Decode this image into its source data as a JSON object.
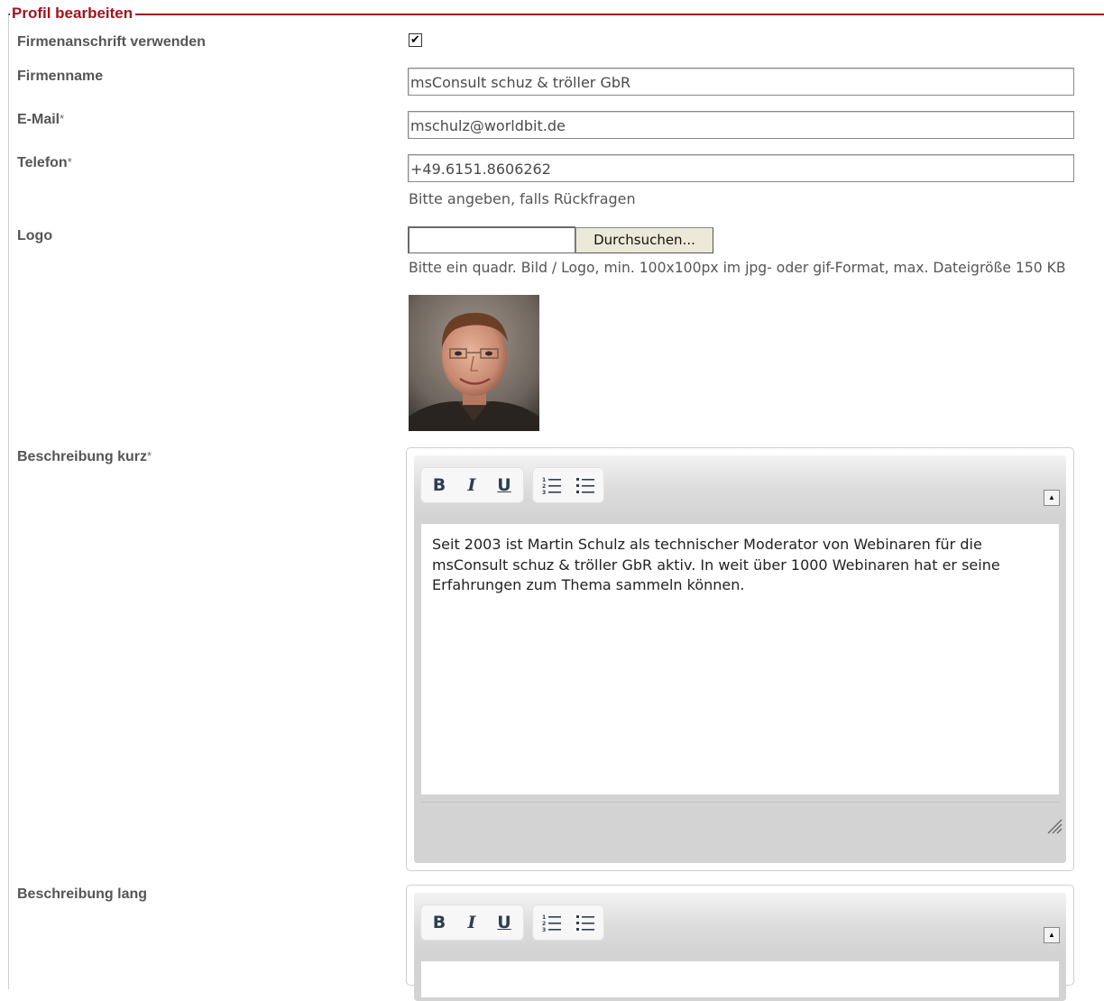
{
  "legend": "Profil bearbeiten",
  "fields": {
    "firmenanschrift": {
      "label": "Firmenanschrift verwenden",
      "checked": "✔"
    },
    "firmenname": {
      "label": "Firmenname",
      "value": "msConsult schuz & tröller GbR"
    },
    "email": {
      "label": "E-Mail",
      "required": "*",
      "value": "mschulz@worldbit.de"
    },
    "telefon": {
      "label": "Telefon",
      "required": "*",
      "value": "+49.6151.8606262",
      "hint": "Bitte angeben, falls Rückfragen"
    },
    "logo": {
      "label": "Logo",
      "browse_button": "Durchsuchen...",
      "hint": "Bitte ein quadr. Bild / Logo, min. 100x100px im jpg- oder gif-Format, max. Dateigröße 150 KB"
    },
    "beschreibung_kurz": {
      "label": "Beschreibung kurz",
      "required": "*",
      "content": "Seit 2003 ist Martin Schulz als technischer Moderator von Webinaren für die msConsult schuz & tröller GbR aktiv. In weit über 1000 Webinaren hat er seine Erfahrungen zum Thema sammeln können."
    },
    "beschreibung_lang": {
      "label": "Beschreibung lang",
      "content": ""
    }
  },
  "toolbar": {
    "bold": "B",
    "italic": "I",
    "underline": "U",
    "collapse": "▲",
    "icons": [
      "bold-icon",
      "italic-icon",
      "underline-icon",
      "ordered-list-icon",
      "unordered-list-icon",
      "collapse-icon",
      "resize-grip-icon"
    ]
  },
  "colors": {
    "accent": "#a0141e",
    "label": "#555555"
  }
}
